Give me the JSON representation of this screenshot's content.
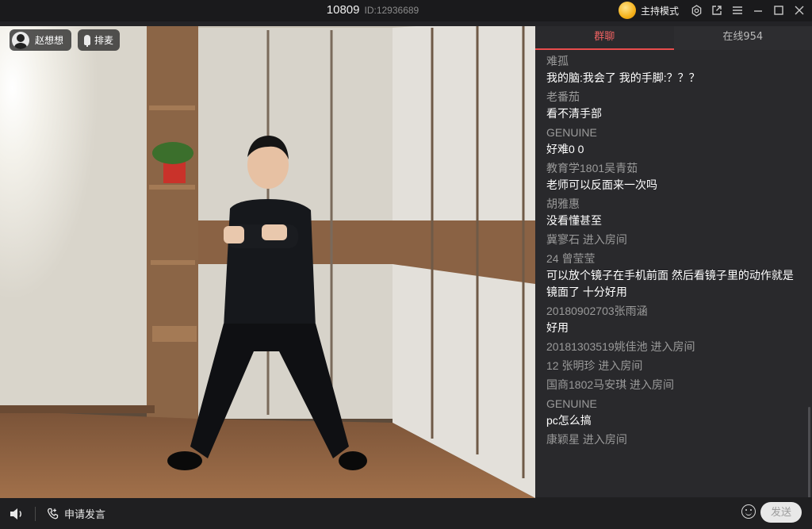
{
  "window": {
    "room_number": "10809",
    "room_id": "ID:12936689",
    "host_mode_label": "主持模式",
    "icons": [
      "coin-icon",
      "settings-icon",
      "popout-icon",
      "menu-icon",
      "minimize-icon",
      "maximize-icon",
      "close-icon"
    ]
  },
  "video": {
    "presenter_name": "赵想想",
    "queue_label": "排麦"
  },
  "controls": {
    "apply_speak_label": "申请发言"
  },
  "chat": {
    "tabs": [
      {
        "label": "群聊",
        "active": true
      },
      {
        "label": "在线954",
        "active": false
      }
    ],
    "messages": [
      {
        "user": "难孤",
        "text": "我的脑:我会了   我的手脚:？？？"
      },
      {
        "user": "老番茄",
        "text": "看不清手部"
      },
      {
        "user": "GENUINE",
        "text": "好难0 0"
      },
      {
        "user": "教育学1801吴青茹",
        "text": "老师可以反面来一次吗"
      },
      {
        "user": "胡雅惠",
        "text": "没看懂甚至"
      },
      {
        "user": "冀寥石 进入房间",
        "text": ""
      },
      {
        "user": "24 曾莹莹",
        "text": "可以放个镜子在手机前面 然后看镜子里的动作就是镜面了 十分好用"
      },
      {
        "user": "20180902703张雨涵",
        "text": "好用"
      },
      {
        "user": "20181303519姚佳池 进入房间",
        "text": ""
      },
      {
        "user": "12 张明珍 进入房间",
        "text": ""
      },
      {
        "user": "国商1802马安琪 进入房间",
        "text": ""
      },
      {
        "user": "GENUINE",
        "text": "pc怎么搞"
      },
      {
        "user": "康颖星 进入房间",
        "text": ""
      }
    ],
    "input_placeholder": "",
    "send_label": "发送"
  },
  "colors": {
    "accent": "#e84c4c",
    "panel_bg": "#29292c",
    "titlebar_bg": "#1a1a1c"
  }
}
